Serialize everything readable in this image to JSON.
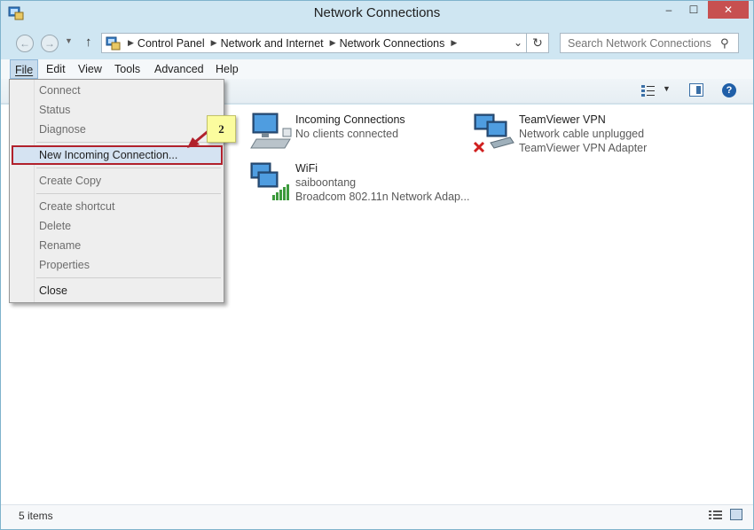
{
  "window": {
    "title": "Network Connections"
  },
  "address": {
    "crumbs": [
      "Control Panel",
      "Network and Internet",
      "Network Connections"
    ],
    "search_placeholder": "Search Network Connections"
  },
  "menu": {
    "file": "File",
    "edit": "Edit",
    "view": "View",
    "tools": "Tools",
    "advanced": "Advanced",
    "help": "Help"
  },
  "file_menu": {
    "connect": "Connect",
    "status": "Status",
    "diagnose": "Diagnose",
    "new_incoming": "New Incoming Connection...",
    "create_copy": "Create Copy",
    "create_shortcut": "Create shortcut",
    "delete": "Delete",
    "rename": "Rename",
    "properties": "Properties",
    "close": "Close"
  },
  "callout": {
    "number": "2"
  },
  "connections": [
    {
      "name": "Incoming Connections",
      "line1": "No clients connected",
      "line2": ""
    },
    {
      "name": "TeamViewer VPN",
      "line1": "Network cable unplugged",
      "line2": "TeamViewer VPN Adapter"
    },
    {
      "name": "WiFi",
      "line1": "saiboontang",
      "line2": "Broadcom 802.11n Network Adap..."
    }
  ],
  "status": {
    "items": "5 items"
  },
  "colors": {
    "highlight_border": "#b1212c",
    "callout_bg": "#fbfc9e",
    "accent": "#1f5fa8"
  }
}
